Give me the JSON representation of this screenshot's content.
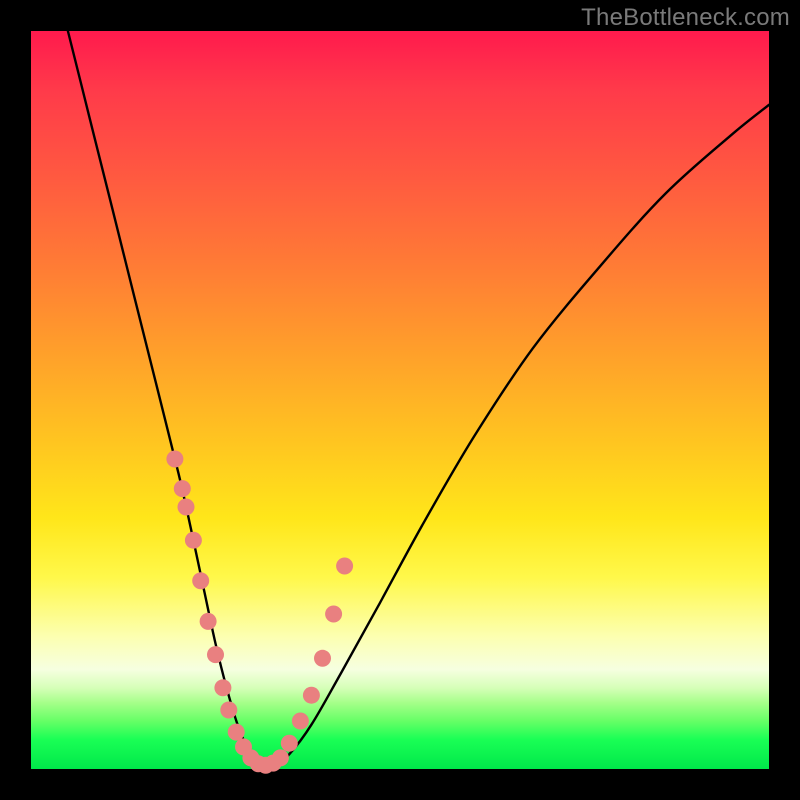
{
  "watermark": "TheBottleneck.com",
  "colors": {
    "frame": "#000000",
    "watermark_text": "#7a7a7a",
    "curve": "#000000",
    "marker_fill": "#e98080",
    "gradient_top": "#ff1a4d",
    "gradient_bottom": "#00e84a"
  },
  "chart_data": {
    "type": "line",
    "title": "",
    "xlabel": "",
    "ylabel": "",
    "xlim": [
      0,
      100
    ],
    "ylim": [
      0,
      100
    ],
    "series": [
      {
        "name": "bottleneck-curve",
        "x": [
          5,
          8,
          11,
          14,
          17,
          20,
          22,
          23.5,
          25,
          26.5,
          28,
          29.5,
          31,
          33,
          35,
          38,
          42,
          47,
          53,
          60,
          68,
          77,
          86,
          95,
          100
        ],
        "y": [
          100,
          88,
          76,
          64,
          52,
          40,
          31,
          24,
          17,
          11,
          6,
          2.5,
          0.5,
          0.5,
          2,
          6,
          13,
          22,
          33,
          45,
          57,
          68,
          78,
          86,
          90
        ]
      }
    ],
    "markers": {
      "name": "highlighted-points",
      "x": [
        19.5,
        20.5,
        21.0,
        22.0,
        23.0,
        24.0,
        25.0,
        26.0,
        26.8,
        27.8,
        28.8,
        29.8,
        30.8,
        31.8,
        32.8,
        33.8,
        35.0,
        36.5,
        38.0,
        39.5,
        41.0,
        42.5
      ],
      "y": [
        42.0,
        38.0,
        35.5,
        31.0,
        25.5,
        20.0,
        15.5,
        11.0,
        8.0,
        5.0,
        3.0,
        1.5,
        0.7,
        0.5,
        0.8,
        1.5,
        3.5,
        6.5,
        10.0,
        15.0,
        21.0,
        27.5
      ]
    }
  }
}
